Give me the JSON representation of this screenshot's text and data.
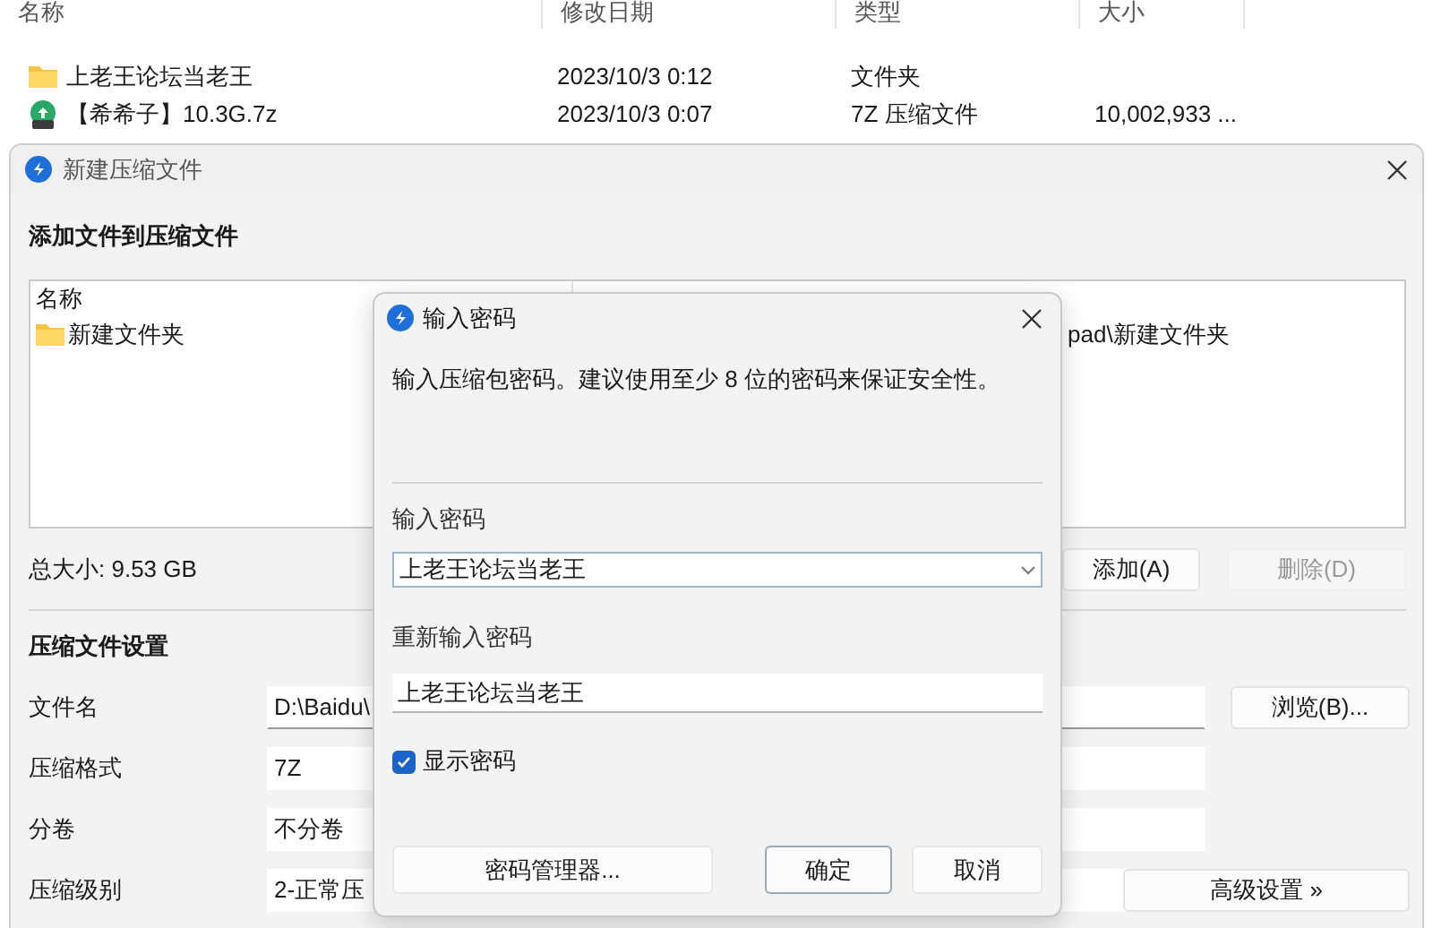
{
  "explorer": {
    "columns": [
      "名称",
      "修改日期",
      "类型",
      "大小"
    ],
    "rows": [
      {
        "kind": "folder",
        "name": "上老王论坛当老王",
        "modified": "2023/10/3 0:12",
        "type": "文件夹"
      },
      {
        "kind": "archive",
        "name": "【希希子】10.3G.7z",
        "modified": "2023/10/3 0:07",
        "type": "7Z 压缩文件",
        "size": "10,002,933 ..."
      }
    ]
  },
  "archive_dialog": {
    "title": "新建压缩文件",
    "files_heading": "添加文件到压缩文件",
    "file_list": {
      "columns": [
        "名称"
      ],
      "rows": [
        {
          "name": "新建文件夹",
          "path": "pad\\新建文件夹"
        }
      ]
    },
    "total_size": "总大小: 9.53 GB",
    "list_buttons": [
      {
        "label": "添加(A)",
        "disabled": false
      },
      {
        "label": "删除(D)",
        "disabled": true
      }
    ],
    "settings_heading": "压缩文件设置",
    "settings": [
      {
        "label": "文件名",
        "value": "D:\\Baidu\\",
        "kind": "text"
      },
      {
        "label": "压缩格式",
        "value": "7Z",
        "kind": "select"
      },
      {
        "label": "分卷",
        "value": "不分卷",
        "kind": "select"
      },
      {
        "label": "压缩级别",
        "value": "2-正常压",
        "kind": "select"
      }
    ],
    "browse_button": "浏览(B)...",
    "advanced_button": "高级设置 »"
  },
  "password_dialog": {
    "title": "输入密码",
    "description": "输入压缩包密码。建议使用至少 8 位的密码来保证安全性。",
    "password_label": "输入密码",
    "password": "上老王论坛当老王",
    "confirm_label": "重新输入密码",
    "confirm": "上老王论坛当老王",
    "show_password": {
      "label": "显示密码",
      "checked": true
    },
    "buttons": [
      {
        "label": "密码管理器...",
        "default": false
      },
      {
        "label": "确定",
        "default": true
      },
      {
        "label": "取消",
        "default": false
      }
    ]
  }
}
